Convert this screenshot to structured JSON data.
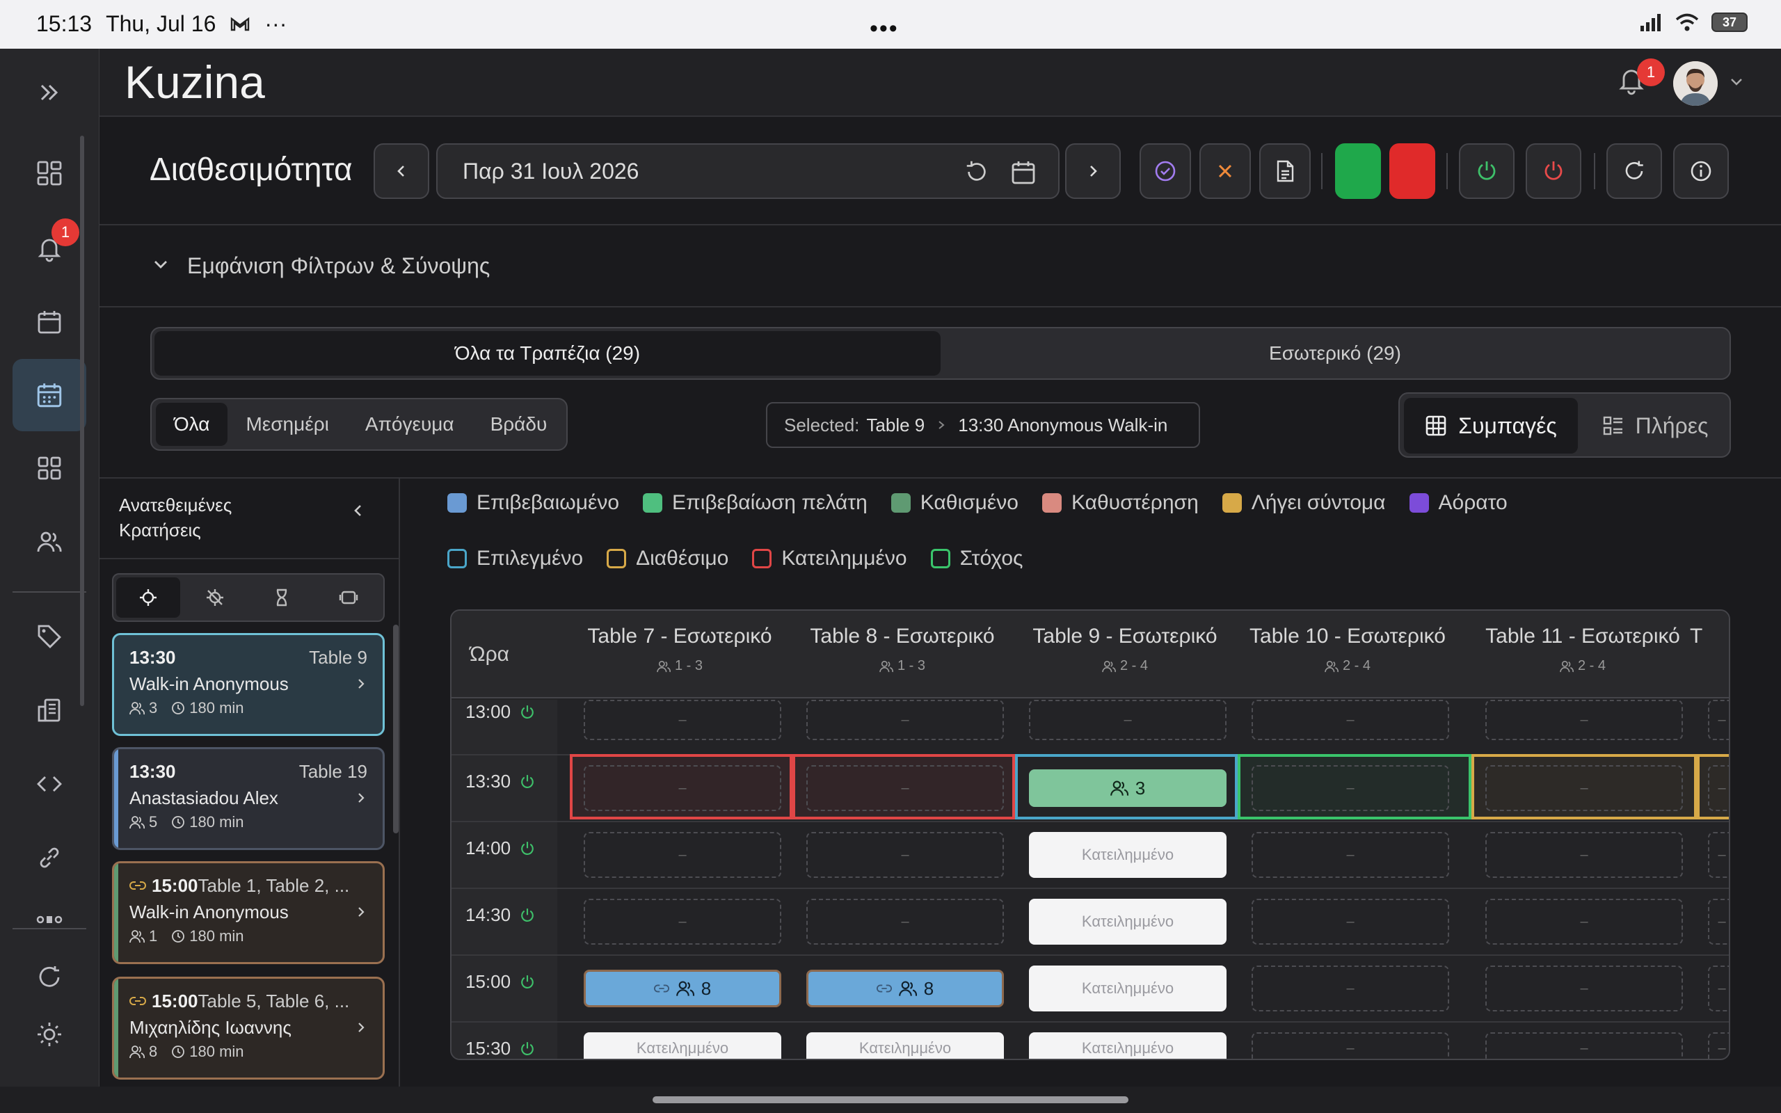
{
  "status_bar": {
    "time": "15:13",
    "date": "Thu, Jul 16",
    "battery": "37"
  },
  "app": {
    "title": "Kuzina",
    "notification_count": "1"
  },
  "sidebar": {
    "notification_count": "1"
  },
  "toolbar": {
    "title": "Διαθεσιμότητα",
    "date": "Παρ 31 Ιουλ 2026"
  },
  "filters": {
    "toggle_label": "Εμφάνιση Φίλτρων & Σύνοψης"
  },
  "tables_segment": {
    "all": "Όλα τα Τραπέζια (29)",
    "indoor": "Εσωτερικό (29)"
  },
  "time_segment": [
    "Όλα",
    "Μεσημέρι",
    "Απόγευμα",
    "Βράδυ"
  ],
  "selection": {
    "label": "Selected:",
    "table": "Table 9",
    "booking": "13:30 Anonymous Walk-in"
  },
  "view": {
    "compact": "Συμπαγές",
    "full": "Πλήρες"
  },
  "unassigned": {
    "title": "Ανατεθειμένες Κρατήσεις",
    "cards": [
      {
        "time": "13:30",
        "tables": "Table 9",
        "name": "Walk-in Anonymous",
        "guests": "3",
        "duration": "180 min",
        "linked": false
      },
      {
        "time": "13:30",
        "tables": "Table 19",
        "name": "Anastasiadou Alex",
        "guests": "5",
        "duration": "180 min",
        "linked": false
      },
      {
        "time": "15:00",
        "tables": "Table 1, Table 2, ...",
        "name": "Walk-in Anonymous",
        "guests": "1",
        "duration": "180 min",
        "linked": true
      },
      {
        "time": "15:00",
        "tables": "Table 5, Table 6, ...",
        "name": "Μιχαηλίδης Ιωαννης",
        "guests": "8",
        "duration": "180 min",
        "linked": true
      }
    ]
  },
  "legend": {
    "fill": [
      {
        "label": "Επιβεβαιωμένο",
        "color": "#6a9ad3"
      },
      {
        "label": "Επιβεβαίωση πελάτη",
        "color": "#4fbf7f"
      },
      {
        "label": "Καθισμένο",
        "color": "#5f9a72"
      },
      {
        "label": "Καθυστέρηση",
        "color": "#d98a80"
      },
      {
        "label": "Λήγει σύντομα",
        "color": "#d7a948"
      },
      {
        "label": "Αόρατο",
        "color": "#7c4cd9"
      }
    ],
    "outline": [
      {
        "label": "Επιλεγμένο",
        "color": "#4aa6c9"
      },
      {
        "label": "Διαθέσιμο",
        "color": "#d7a948"
      },
      {
        "label": "Κατειλημμένο",
        "color": "#e04646"
      },
      {
        "label": "Στόχος",
        "color": "#3ac46b"
      }
    ]
  },
  "grid": {
    "time_header": "Ώρα",
    "columns": [
      {
        "name": "Table 7 - Εσωτερικό",
        "capacity": "1 - 3"
      },
      {
        "name": "Table 8 - Εσωτερικό",
        "capacity": "1 - 3"
      },
      {
        "name": "Table 9 - Εσωτερικό",
        "capacity": "2 - 4"
      },
      {
        "name": "Table 10 - Εσωτερικό",
        "capacity": "2 - 4"
      },
      {
        "name": "Table 11 - Εσωτερικό",
        "capacity": "2 - 4"
      },
      {
        "name": "T",
        "capacity": ""
      }
    ],
    "times": [
      "13:00",
      "13:30",
      "14:00",
      "14:30",
      "15:00",
      "15:30"
    ],
    "empty_symbol": "–",
    "occupied_label": "Κατειλημμένο",
    "seated_guests": "3",
    "booking_guests": "8"
  }
}
